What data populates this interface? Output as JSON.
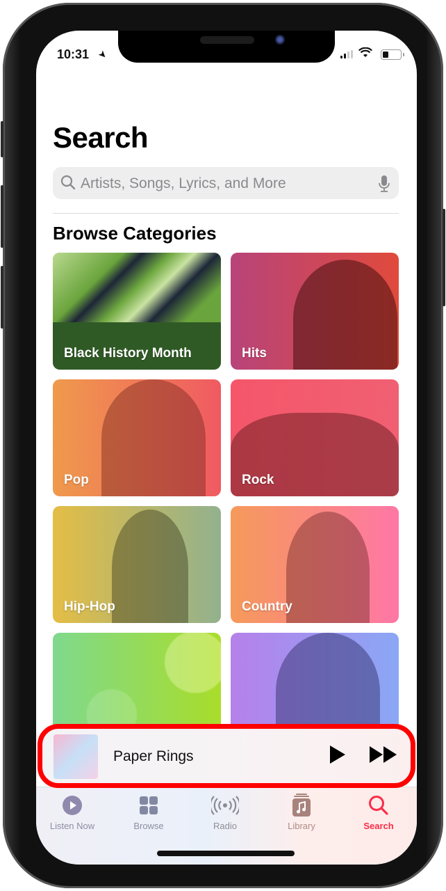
{
  "status_bar": {
    "time": "10:31",
    "location_icon": "location-arrow-icon",
    "signal_icon": "cellular-signal-icon",
    "wifi_icon": "wifi-icon",
    "battery_icon": "battery-icon",
    "battery_level": 0.3
  },
  "page": {
    "title": "Search",
    "search": {
      "placeholder": "Artists, Songs, Lyrics, and More",
      "value": "",
      "search_icon": "magnifying-glass-icon",
      "mic_icon": "microphone-icon"
    },
    "section_title": "Browse Categories",
    "categories": [
      {
        "label": "Black History Month"
      },
      {
        "label": "Hits"
      },
      {
        "label": "Pop"
      },
      {
        "label": "Rock"
      },
      {
        "label": "Hip-Hop"
      },
      {
        "label": "Country"
      },
      {
        "label": ""
      },
      {
        "label": ""
      }
    ]
  },
  "mini_player": {
    "track_title": "Paper Rings",
    "play_icon": "play-icon",
    "forward_icon": "fast-forward-icon",
    "highlight_color": "#ff0000"
  },
  "tab_bar": {
    "active_color": "#fa2d48",
    "tabs": [
      {
        "label": "Listen Now",
        "icon": "play-circle-icon",
        "active": false
      },
      {
        "label": "Browse",
        "icon": "grid-icon",
        "active": false
      },
      {
        "label": "Radio",
        "icon": "radio-waves-icon",
        "active": false
      },
      {
        "label": "Library",
        "icon": "music-library-icon",
        "active": false
      },
      {
        "label": "Search",
        "icon": "search-icon",
        "active": true
      }
    ]
  }
}
